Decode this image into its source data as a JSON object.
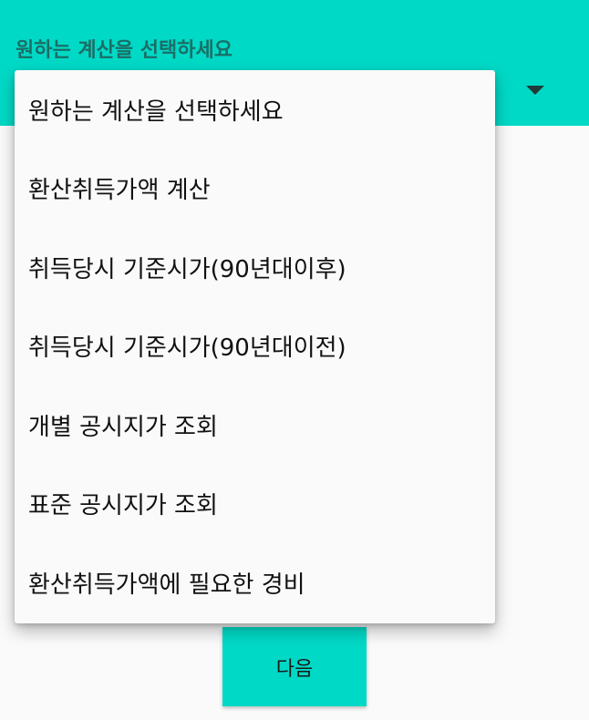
{
  "header": {
    "title": "원하는 계산을 선택하세요",
    "accent_color": "#00d9c6",
    "spinner_icon": "triangle-down-icon"
  },
  "dropdown": {
    "items": [
      {
        "label": "원하는 계산을 선택하세요"
      },
      {
        "label": "환산취득가액 계산"
      },
      {
        "label": "취득당시 기준시가(90년대이후)"
      },
      {
        "label": "취득당시 기준시가(90년대이전)"
      },
      {
        "label": "개별 공시지가 조회"
      },
      {
        "label": "표준 공시지가 조회"
      },
      {
        "label": "환산취득가액에 필요한 경비"
      }
    ]
  },
  "footer": {
    "next_label": "다음"
  }
}
